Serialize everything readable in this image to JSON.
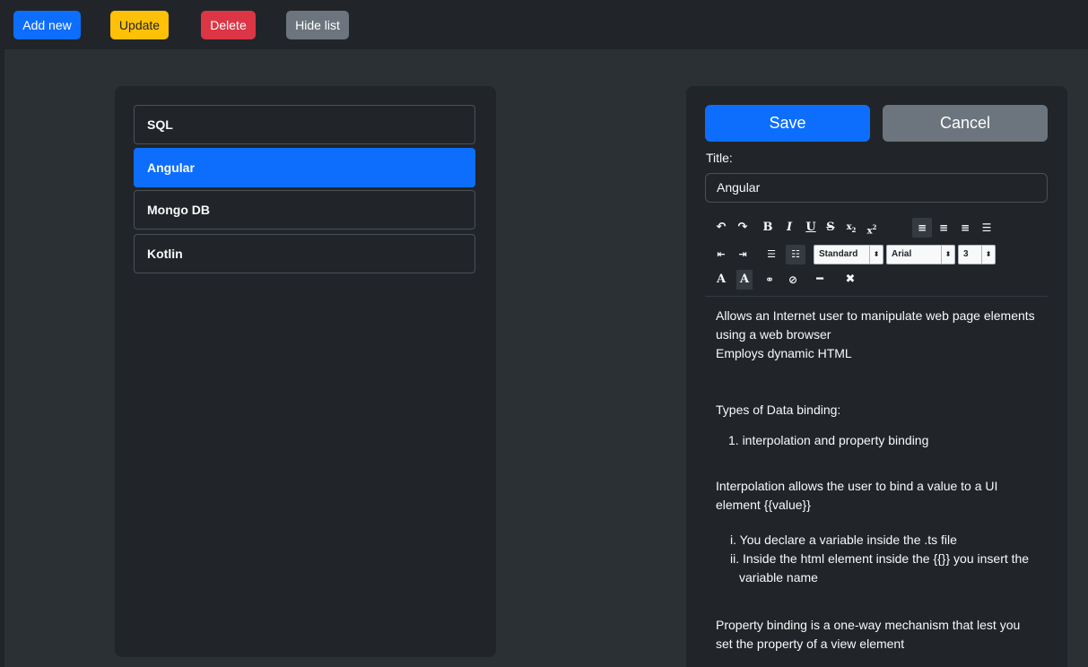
{
  "toolbar": {
    "add_label": "Add new",
    "update_label": "Update",
    "delete_label": "Delete",
    "hide_label": "Hide list"
  },
  "list": {
    "items": [
      {
        "label": "SQL",
        "active": false
      },
      {
        "label": "Angular",
        "active": true
      },
      {
        "label": "Mongo DB",
        "active": false
      },
      {
        "label": "Kotlin",
        "active": false
      }
    ]
  },
  "editor": {
    "save_label": "Save",
    "cancel_label": "Cancel",
    "title_label": "Title:",
    "title_value": "Angular",
    "format_select": "Standard",
    "font_select": "Arial",
    "size_select": "3",
    "content": {
      "p1": "Allows an Internet user to manipulate web page elements using a web browser",
      "p2": "Employs dynamic HTML",
      "p3": "Types of Data binding:",
      "ol1": "1. interpolation and property binding",
      "p4": "Interpolation allows the user to bind a value to a UI element {{value}}",
      "r1": "i. You declare a variable inside the .ts file",
      "r2": "ii. Inside the html element inside the {{}} you insert the variable name",
      "p5": "Property binding is a one-way mechanism that lest you set the property of a view element"
    }
  },
  "colors": {
    "primary": "#0d6efd",
    "warning": "#ffc107",
    "danger": "#dc3545",
    "secondary": "#6c757d",
    "panel": "#212529",
    "background": "#2b3035"
  }
}
